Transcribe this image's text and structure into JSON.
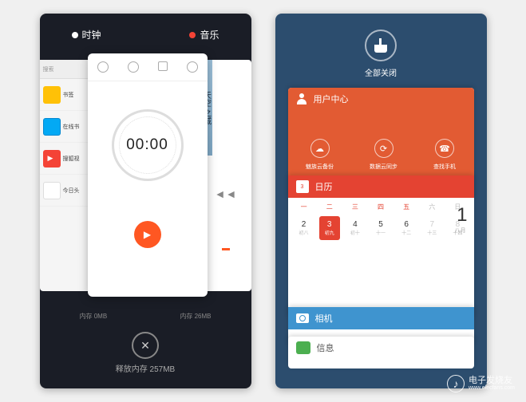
{
  "left": {
    "apps": {
      "clock": "时钟",
      "music": "音乐"
    },
    "browser": {
      "search_placeholder": "搜索",
      "items": [
        {
          "label": "书签"
        },
        {
          "label": "在线书"
        },
        {
          "label": "搜狐视"
        },
        {
          "label": "今日头"
        }
      ]
    },
    "clock": {
      "time": "00:00",
      "play": "▶"
    },
    "music": {
      "art_text": "天空 之城",
      "prev": "◄◄"
    },
    "memory": {
      "clock_mem": "内存 0MB",
      "music_mem": "内存 26MB"
    },
    "close": "✕",
    "release": "释放内存 257MB"
  },
  "right": {
    "clean_all": "全部关闭",
    "user": {
      "title": "用户中心",
      "items": [
        {
          "icon": "☁",
          "label": "魅族云备份"
        },
        {
          "icon": "⟳",
          "label": "数据云同步"
        },
        {
          "icon": "☎",
          "label": "查找手机"
        }
      ]
    },
    "calendar": {
      "title": "日历",
      "icon_day": "3",
      "week": [
        "一",
        "二",
        "三",
        "四",
        "五",
        "六",
        "日"
      ],
      "big_day": "1",
      "big_sub": "八月",
      "rows": [
        [
          {
            "d": "2",
            "l": "初八"
          },
          {
            "d": "3",
            "l": "初九",
            "today": true
          },
          {
            "d": "4",
            "l": "初十"
          },
          {
            "d": "5",
            "l": "十一"
          },
          {
            "d": "6",
            "l": "十二"
          },
          {
            "d": "7",
            "l": "十三"
          },
          {
            "d": "8",
            "l": "十四"
          }
        ]
      ]
    },
    "camera": {
      "title": "相机"
    },
    "messages": {
      "title": "信息"
    }
  },
  "watermark": {
    "icon": "♪",
    "name": "电子发烧友",
    "url": "www.elecfans.com"
  }
}
